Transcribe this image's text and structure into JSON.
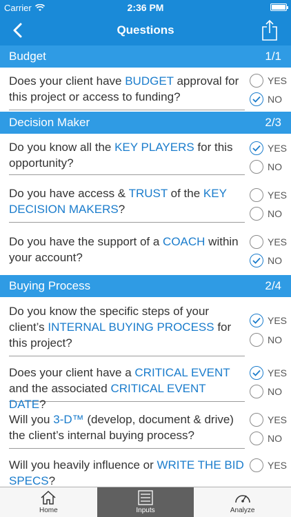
{
  "status": {
    "carrier": "Carrier",
    "time": "2:36 PM"
  },
  "nav": {
    "title": "Questions",
    "back_icon": "chevron-left-icon",
    "share_icon": "share-icon"
  },
  "options": {
    "yes": "YES",
    "no": "NO"
  },
  "sections": [
    {
      "title": "Budget",
      "count": "1/1"
    },
    {
      "title": "Decision Maker",
      "count": "2/3"
    },
    {
      "title": "Buying Process",
      "count": "2/4"
    }
  ],
  "questions": {
    "q1": {
      "a": "Does your client have ",
      "b": "BUDGET",
      "c": " approval for this project or access to funding?",
      "answer": "NO"
    },
    "q2": {
      "a": "Do you know all the ",
      "b": "KEY PLAYERS",
      "c": " for this opportunity?",
      "answer": "YES"
    },
    "q3": {
      "a": "Do you have access & ",
      "b": "TRUST",
      "c": " of the ",
      "d": "KEY DECISION MAKERS",
      "e": "?",
      "answer": ""
    },
    "q4": {
      "a": "Do you have the support of a ",
      "b": "COACH",
      "c": " within your account?",
      "answer": "NO"
    },
    "q5": {
      "a": "Do you know the specific steps of your client’s ",
      "b": "INTERNAL BUYING PROCESS",
      "c": " for this project?",
      "answer": "YES"
    },
    "q6": {
      "a": "Does your client have a ",
      "b": "CRITICAL EVENT",
      "c": " and the associated ",
      "d": "CRITICAL EVENT DATE",
      "e": "?",
      "answer": "YES"
    },
    "q7": {
      "a": "Will you ",
      "b": "3-D™",
      "c": " (develop, document & drive) the client’s internal buying process?",
      "answer": ""
    },
    "q8": {
      "a": "Will you heavily influence or ",
      "b": "WRITE THE BID SPECS",
      "c": "?",
      "answer": ""
    }
  },
  "tabs": [
    {
      "label": "Home",
      "icon": "home-icon",
      "active": false
    },
    {
      "label": "Inputs",
      "icon": "list-icon",
      "active": true
    },
    {
      "label": "Analyze",
      "icon": "gauge-icon",
      "active": false
    }
  ],
  "colors": {
    "primary": "#1a8ad8",
    "section": "#2f9be4",
    "keyword": "#1a7ccc"
  }
}
